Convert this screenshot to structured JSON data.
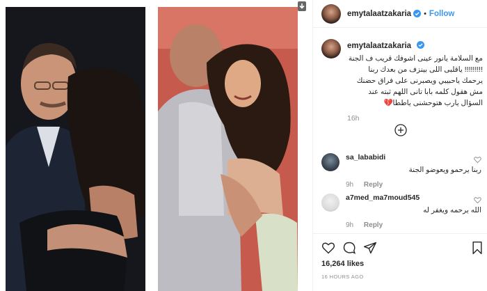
{
  "post": {
    "username": "emytalaatzakaria",
    "follow_label": "Follow",
    "separator": "•"
  },
  "caption": {
    "username": "emytalaatzakaria",
    "text": "مع السلامة يانور عينى اشوفك قريب ف الجنة !!!!!!!!! ياقلبى اللى بينزف من بعدك ربنا يرحمك ياحبيبي ويصبرنى على فراق حضنك مش هقول كلمه بابا تانى اللهم ثبته عند السؤال يارب هتوحشنى ياططا💔",
    "time": "16h"
  },
  "comments": [
    {
      "username": "sa_lababidi",
      "text": "ربنا يرحمو ويعوضو الجنة",
      "time": "9h",
      "reply_label": "Reply"
    },
    {
      "username": "a7med_ma7moud545",
      "text": "الله يرحمه ويغفر له",
      "time": "9h",
      "reply_label": "Reply"
    }
  ],
  "stats": {
    "likes": "16,264 likes",
    "ago": "16 HOURS AGO"
  },
  "colors": {
    "accent": "#3897f0",
    "verified": "#3897f0",
    "secondary_text": "#8e8e8e",
    "border": "#efefef"
  },
  "icons": {
    "download": "download-icon",
    "more": "plus-circle-icon",
    "like": "heart-icon",
    "comment": "comment-icon",
    "share": "share-icon",
    "save": "bookmark-icon"
  }
}
